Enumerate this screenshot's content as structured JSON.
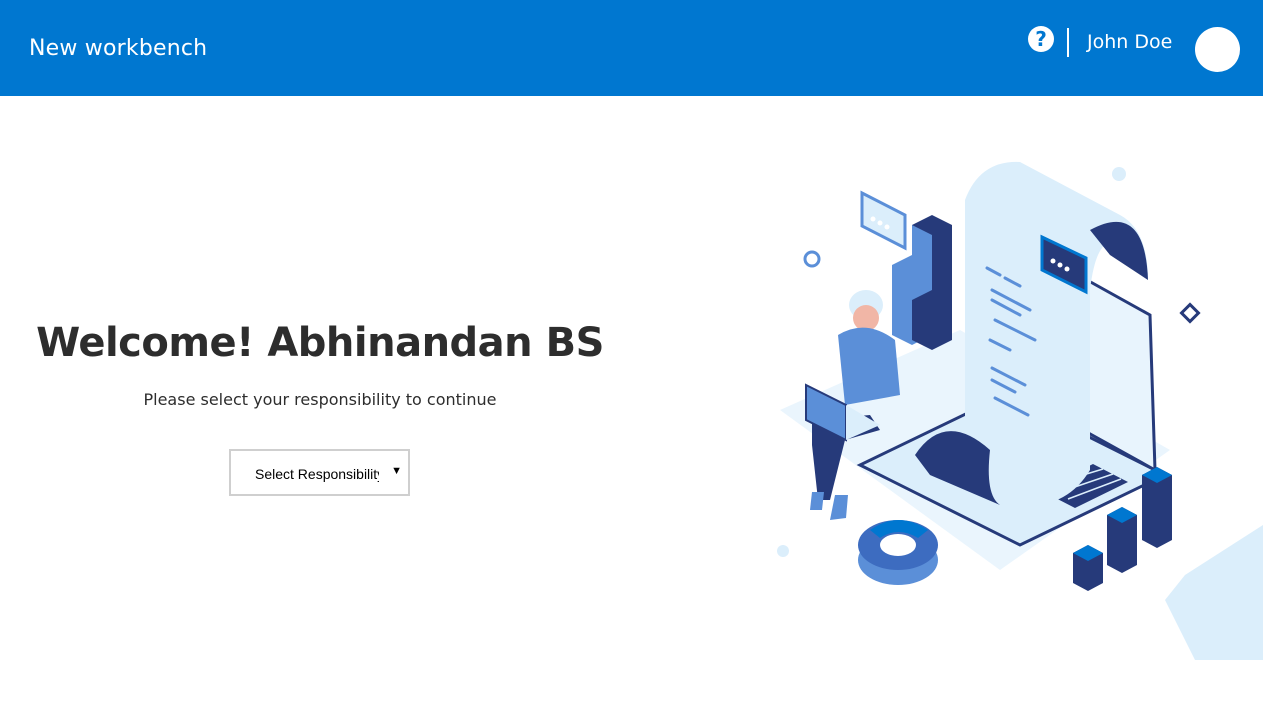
{
  "header": {
    "app_title": "New workbench",
    "help_icon": "question-circle-icon",
    "user_name": "John Doe"
  },
  "main": {
    "welcome_text": "Welcome! Abhinandan BS",
    "subtitle": "Please select your responsibility to continue",
    "responsibility_select": {
      "selected": "Select Responsibility"
    }
  },
  "colors": {
    "brand_blue": "#0077d0",
    "dark_navy": "#263a7a",
    "light_blue": "#dbeefb",
    "mid_blue": "#5b8fd8"
  }
}
